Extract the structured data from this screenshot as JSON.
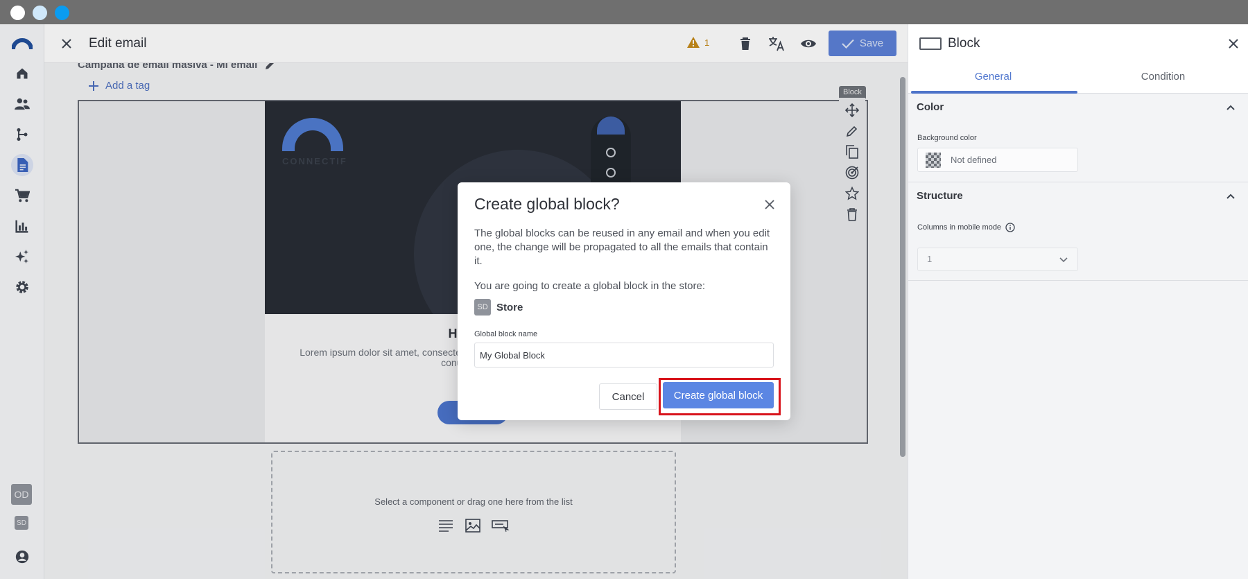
{
  "window": {
    "traffic_lights": [
      "white",
      "light-blue",
      "blue"
    ]
  },
  "nav": {
    "items": [
      {
        "icon": "home-icon"
      },
      {
        "icon": "users-icon"
      },
      {
        "icon": "workflow-icon"
      },
      {
        "icon": "document-icon",
        "active": true
      },
      {
        "icon": "cart-icon"
      },
      {
        "icon": "chart-icon"
      },
      {
        "icon": "sparkles-icon"
      },
      {
        "icon": "settings-icon"
      }
    ],
    "org_badge": "OD",
    "store_badge": "SD"
  },
  "header": {
    "title": "Edit email",
    "warning_count": "1",
    "save_label": "Save"
  },
  "editor": {
    "campaign_name": "Campaña de email masiva - Mi email",
    "add_tag": "Add a tag",
    "block_tag": "Block",
    "email": {
      "logo_text": "CONNECTIF",
      "heading": "Hola {{C",
      "body": "Lorem ipsum dolor sit amet, consectet aliquam ante vel, tristique porta ligula. per conubia nostra",
      "cta": "LE"
    },
    "dropzone_text": "Select a component or drag one here from the list"
  },
  "right_panel": {
    "title": "Block",
    "tabs": [
      "General",
      "Condition"
    ],
    "active_tab": "General",
    "color_section": "Color",
    "background_color_label": "Background color",
    "background_color_value": "Not defined",
    "structure_section": "Structure",
    "columns_mobile_label": "Columns in mobile mode",
    "columns_mobile_value": "1"
  },
  "modal": {
    "title": "Create global block?",
    "description": "The global blocks can be reused in any email and when you edit one, the change will be propagated to all the emails that contain it.",
    "store_intro": "You are going to create a global block in the store:",
    "store_badge": "SD",
    "store_name": "Store",
    "name_label": "Global block name",
    "name_value": "My Global Block",
    "cancel_label": "Cancel",
    "create_label": "Create global block"
  },
  "colors": {
    "primary": "#5b86e3",
    "highlight": "#d8141c",
    "warning": "#c58a1a"
  }
}
